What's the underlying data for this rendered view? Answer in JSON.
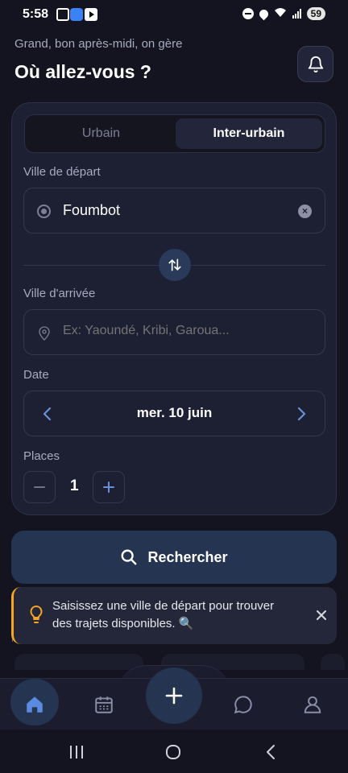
{
  "status_bar": {
    "time": "5:58",
    "battery": "59"
  },
  "header": {
    "greeting": "Grand, bon après-midi, on gère",
    "title": "Où allez-vous ?"
  },
  "trip_type": {
    "tabs": [
      "Urbain",
      "Inter-urbain"
    ],
    "selected": "Inter-urbain"
  },
  "departure": {
    "label": "Ville de départ",
    "value": "Foumbot"
  },
  "arrival": {
    "label": "Ville d'arrivée",
    "placeholder": "Ex: Yaoundé, Kribi, Garoua..."
  },
  "date": {
    "label": "Date",
    "value": "mer. 10 juin"
  },
  "places": {
    "label": "Places",
    "value": "1"
  },
  "search": {
    "label": "Rechercher"
  },
  "toast": {
    "text": "Saisissez une ville de départ pour trouver des trajets disponibles. 🔍"
  },
  "bottom_nav": {
    "items": [
      "home-icon",
      "calendar-icon",
      "plus-icon",
      "chat-icon",
      "user-icon"
    ],
    "active": "home-icon"
  },
  "colors": {
    "background": "#13141f",
    "card": "#1d1f33",
    "accent": "#243451",
    "warning": "#f5a623"
  }
}
